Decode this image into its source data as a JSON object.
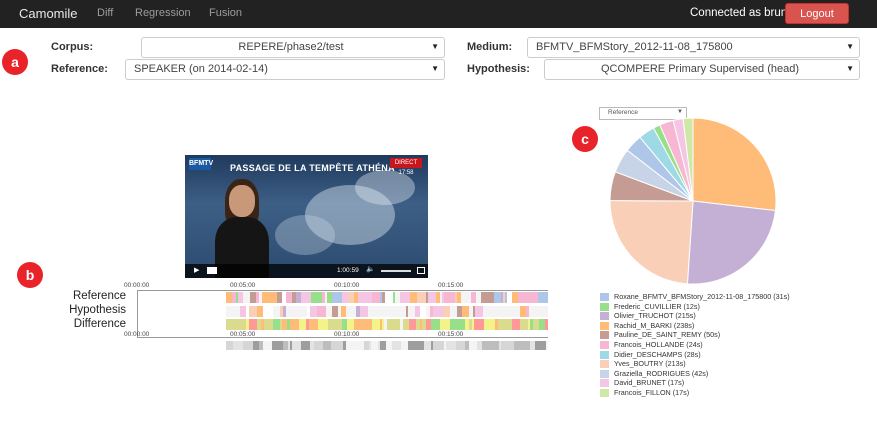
{
  "navbar": {
    "brand": "Camomile",
    "links": [
      "Diff",
      "Regression",
      "Fusion"
    ],
    "connected": "Connected as bruneau",
    "logout": "Logout"
  },
  "badges": [
    "a",
    "b",
    "c"
  ],
  "form": {
    "corpus_label": "Corpus:",
    "corpus_value": "REPERE/phase2/test",
    "medium_label": "Medium:",
    "medium_value": "BFMTV_BFMStory_2012-11-08_175800",
    "reference_label": "Reference:",
    "reference_value": "SPEAKER (on 2014-02-14)",
    "hypothesis_label": "Hypothesis:",
    "hypothesis_value": "QCOMPERE Primary Supervised (head)"
  },
  "video": {
    "channel": "BFMTV",
    "headline": "PASSAGE DE LA TEMPÊTE ATHÉNA",
    "live_badge": "DIRECT 17:58",
    "time": "1:00:59"
  },
  "timeline": {
    "labels": [
      "Reference",
      "Hypothesis",
      "Difference"
    ],
    "ticks_top": [
      "00:00:00",
      "00:05:00",
      "00:10:00",
      "00:15:00"
    ],
    "ticks_bottom": [
      "00:00:00",
      "00:05:00",
      "00:10:00",
      "00:15:00"
    ]
  },
  "pie": {
    "selector": "Reference",
    "colors": [
      "#aec7e8",
      "#98df8a",
      "#c5b0d5",
      "#f7b6d2",
      "#c49c94",
      "#f7b6d2",
      "#9edae5",
      "#ffbb78",
      "#c7c7c7",
      "#f7c4df",
      "#dbdb8d",
      "#ff9896"
    ]
  },
  "chart_data": {
    "type": "pie",
    "categories": [
      "Roxane_BFMTV_BFMStory_2012-11-08_175800",
      "Frederic_CUVILLIER",
      "Olivier_TRUCHOT",
      "Rachid_M_BARKI",
      "Pauline_DE_SAINT_REMY",
      "Francois_HOLLANDE",
      "Didier_DESCHAMPS",
      "Yves_BOUTRY",
      "Graziella_RODRIGUES",
      "David_BRUNET",
      "Francois_FILLON"
    ],
    "values": [
      31,
      12,
      215,
      238,
      50,
      24,
      28,
      213,
      42,
      17,
      17
    ],
    "legend": [
      {
        "label": "Roxane_BFMTV_BFMStory_2012-11-08_175800 (31s)",
        "color": "#aec7e8"
      },
      {
        "label": "Frederic_CUVILLIER (12s)",
        "color": "#98df8a"
      },
      {
        "label": "Olivier_TRUCHOT (215s)",
        "color": "#c5b0d5"
      },
      {
        "label": "Rachid_M_BARKI (238s)",
        "color": "#ffbb78"
      },
      {
        "label": "Pauline_DE_SAINT_REMY (50s)",
        "color": "#c49c94"
      },
      {
        "label": "Francois_HOLLANDE (24s)",
        "color": "#f7b6d2"
      },
      {
        "label": "Didier_DESCHAMPS (28s)",
        "color": "#9edae5"
      },
      {
        "label": "Yves_BOUTRY (213s)",
        "color": "#f9cfb8"
      },
      {
        "label": "Graziella_RODRIGUES (42s)",
        "color": "#c7d3e6"
      },
      {
        "label": "David_BRUNET (17s)",
        "color": "#f4c6e3"
      },
      {
        "label": "Francois_FILLON (17s)",
        "color": "#cfe8a8"
      }
    ],
    "legend_position": "bottom"
  }
}
